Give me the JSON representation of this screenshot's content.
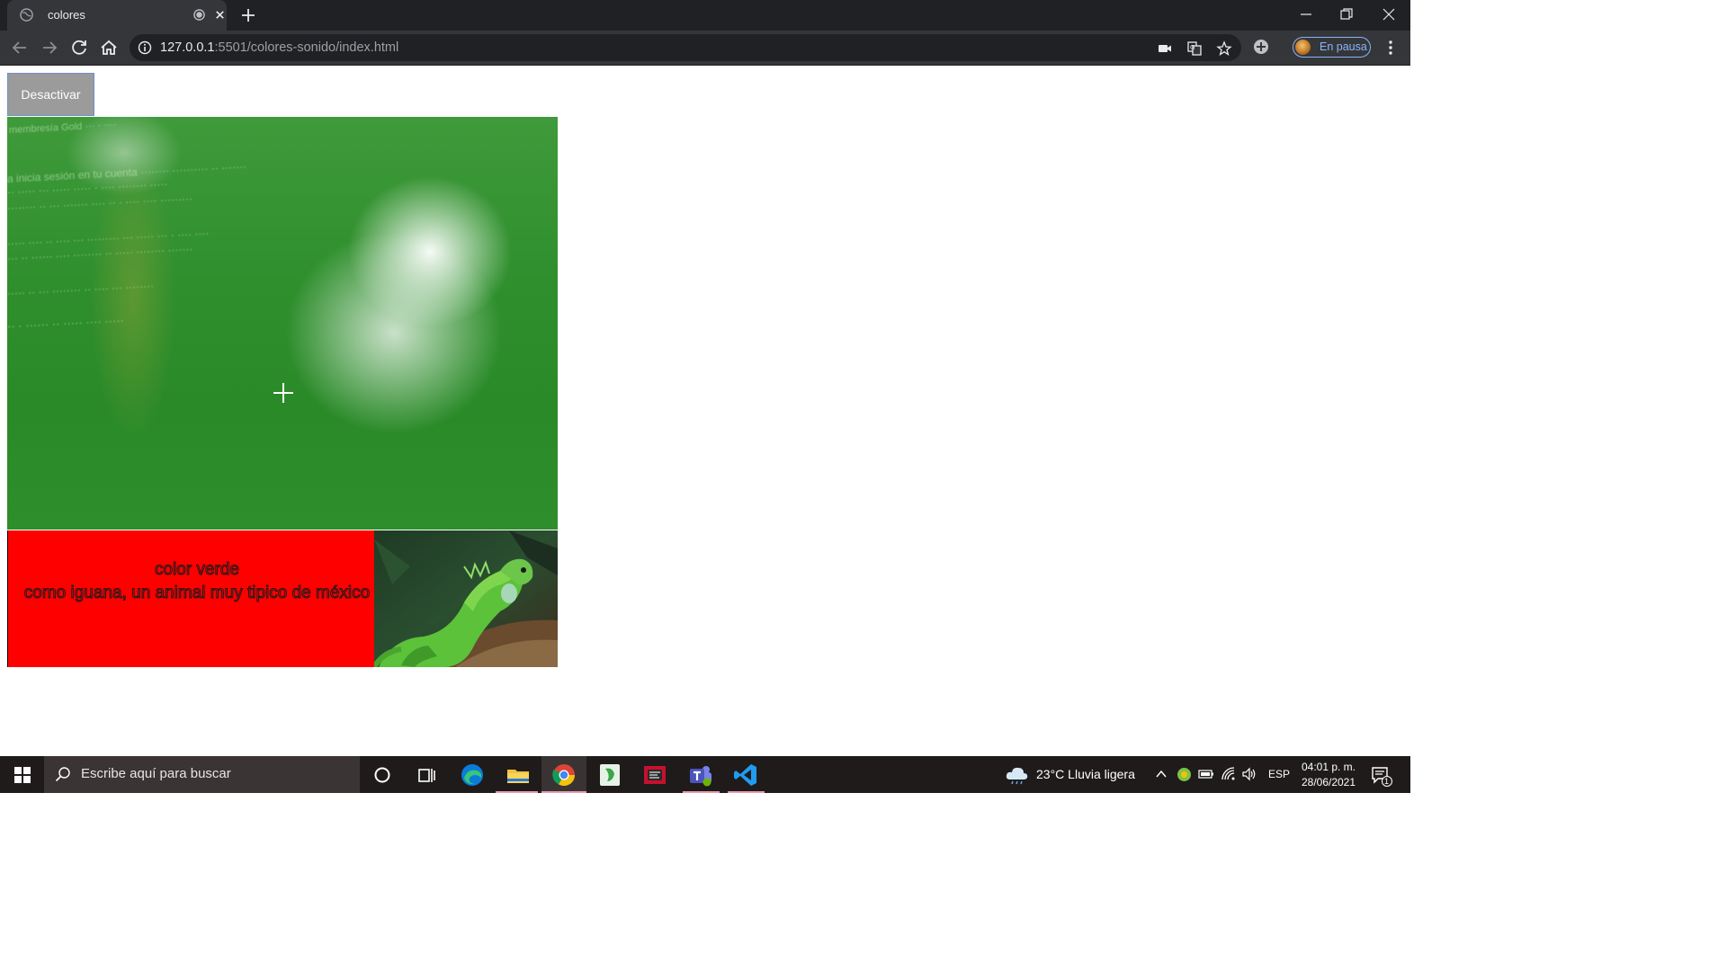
{
  "browser": {
    "tab_title": "colores",
    "url_host": "127.0.0.1",
    "url_rest": ":5501/colores-sonido/index.html",
    "profile_label": "En pausa"
  },
  "page": {
    "button_label": "Desactivar",
    "panel_color": "#ff0000",
    "color_line": "color verde",
    "description_line": "como iguana, un animal muy tipico de méxico"
  },
  "taskbar": {
    "search_placeholder": "Escribe aquí para buscar",
    "weather": "23°C  Lluvia ligera",
    "language": "ESP",
    "time": "04:01 p. m.",
    "date": "28/06/2021",
    "notification_count": "1"
  }
}
